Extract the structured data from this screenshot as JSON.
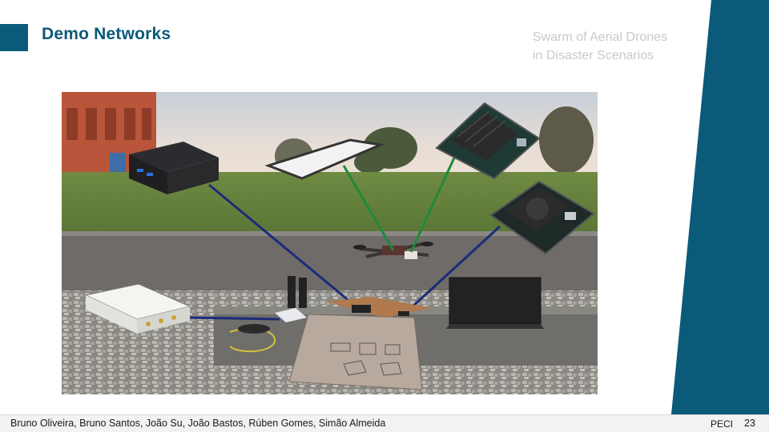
{
  "slide": {
    "title": "Demo Networks",
    "subtitle_line1": "Swarm of Aerial Drones",
    "subtitle_line2": "in Disaster Scenarios",
    "accent_color": "#0b5a7a"
  },
  "footer": {
    "authors": "Bruno Oliveira, Bruno Santos, João Su, João Bastos, Rúben Gomes, Simão Almeida",
    "brand": "PECI",
    "page_number": "23"
  },
  "figure": {
    "link_colors": {
      "blue": "#1c2b7a",
      "green": "#1f8a3a"
    }
  }
}
